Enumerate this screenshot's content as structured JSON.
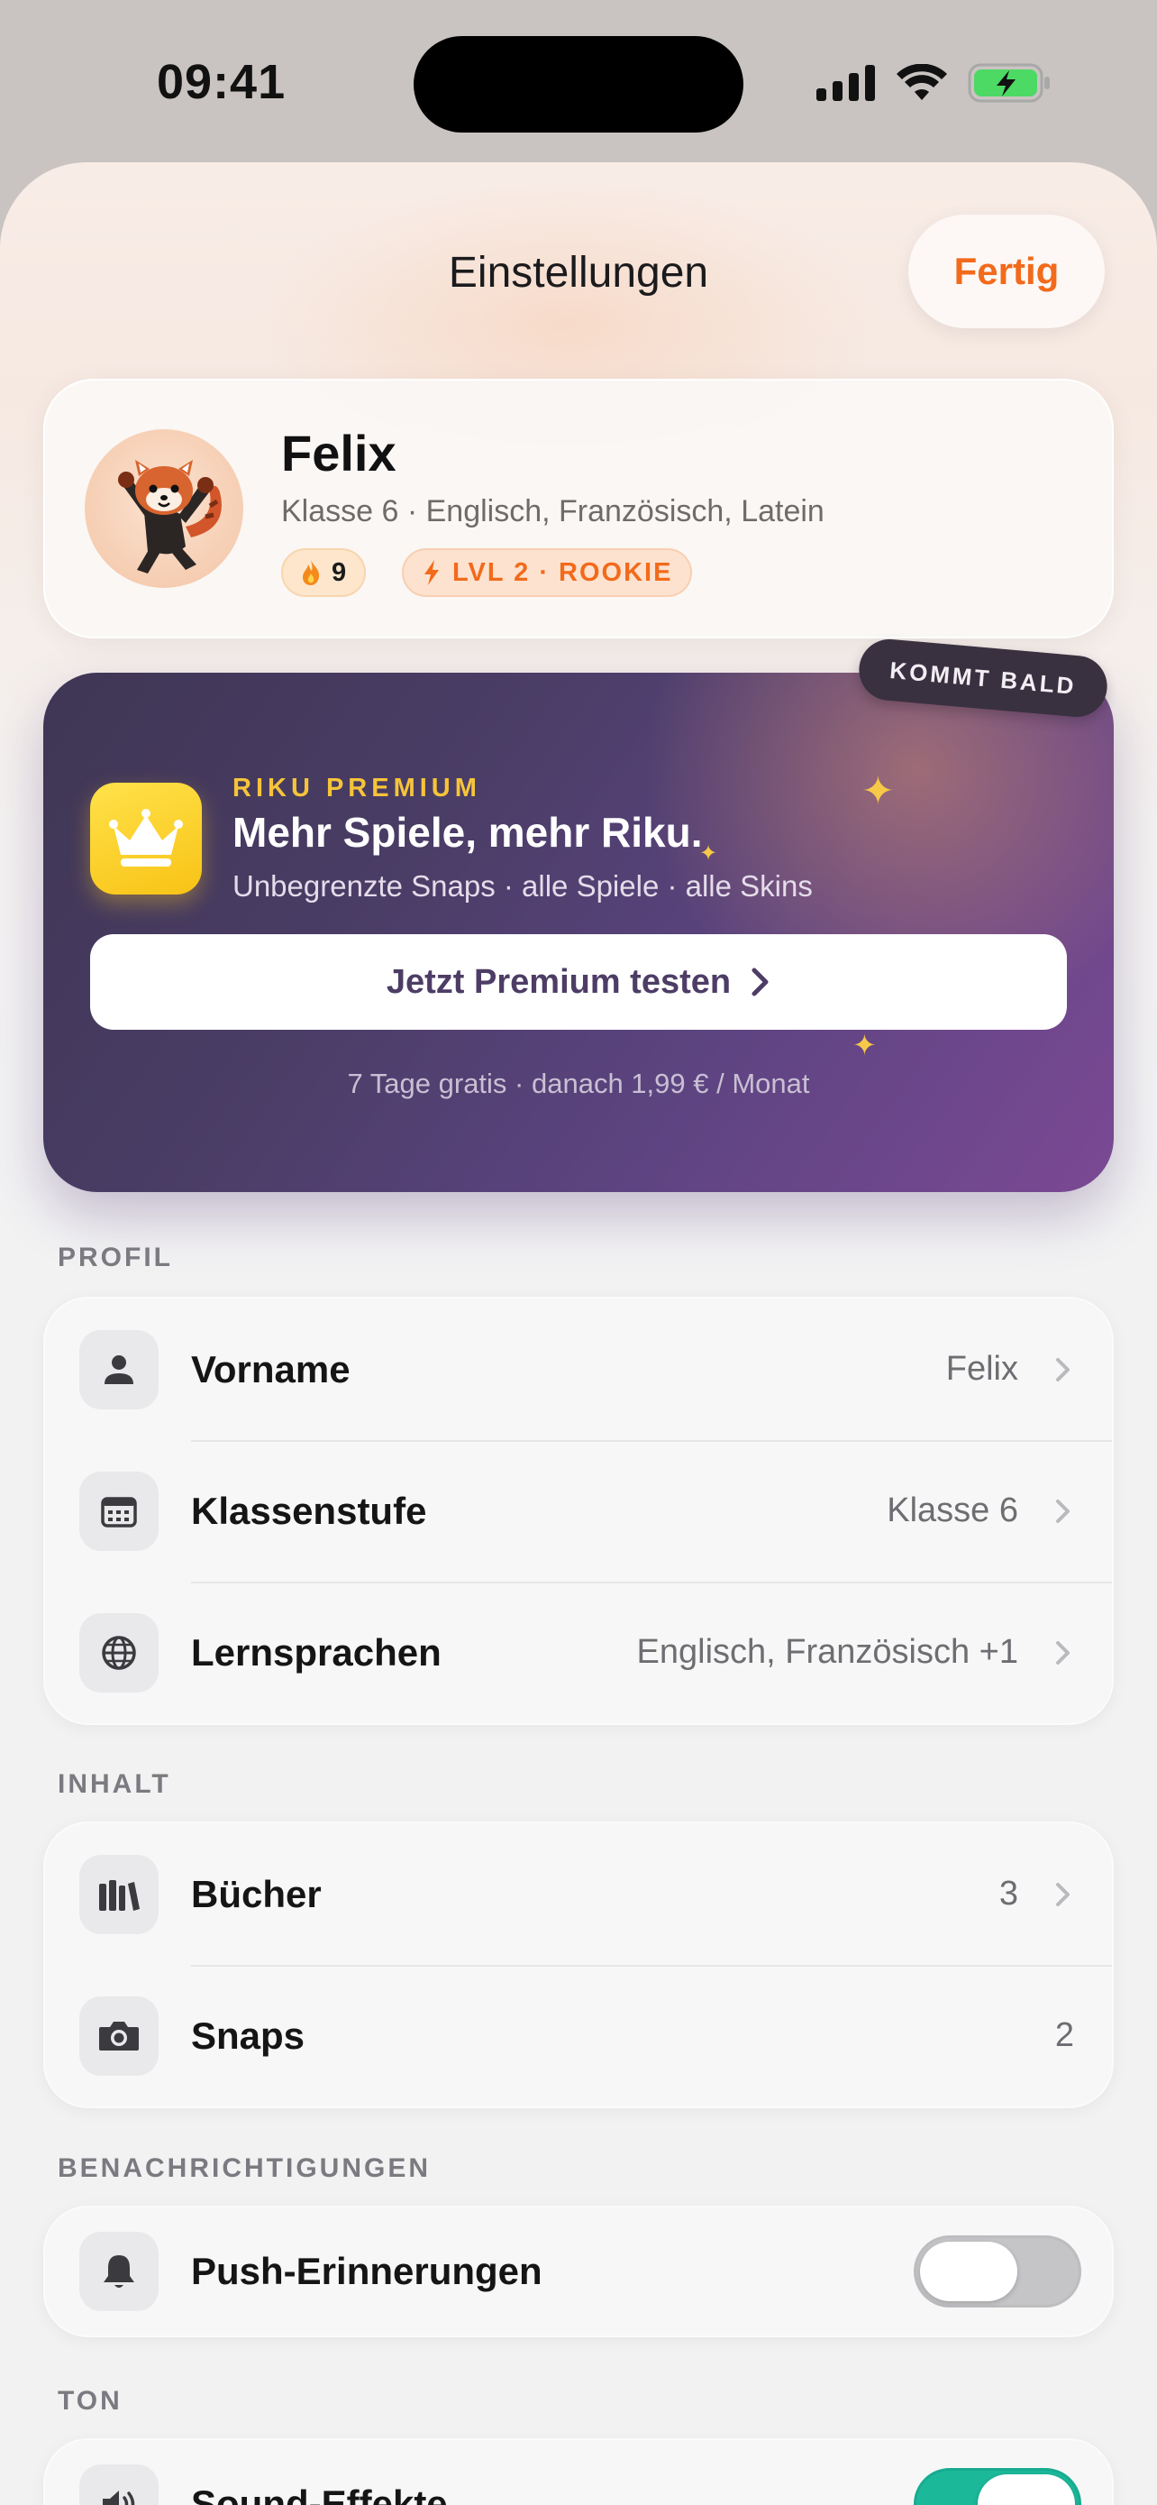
{
  "status_bar": {
    "time": "09:41"
  },
  "nav": {
    "title": "Einstellungen",
    "done_label": "Fertig"
  },
  "profile": {
    "name": "Felix",
    "subtitle": "Klasse 6 · Englisch, Französisch, Latein",
    "streak": "9",
    "level": "LVL 2 · ROOKIE"
  },
  "premium": {
    "badge": "KOMMT BALD",
    "eyebrow": "RIKU PREMIUM",
    "title": "Mehr Spiele, mehr Riku.",
    "subtitle": "Unbegrenzte Snaps · alle Spiele · alle Skins",
    "cta": "Jetzt Premium testen",
    "footnote": "7 Tage gratis · danach 1,99 € / Monat"
  },
  "sections": {
    "profil": {
      "label": "PROFIL",
      "rows": [
        {
          "label": "Vorname",
          "value": "Felix",
          "icon": "person-icon"
        },
        {
          "label": "Klassenstufe",
          "value": "Klasse 6",
          "icon": "calendar-icon"
        },
        {
          "label": "Lernsprachen",
          "value": "Englisch, Französisch +1",
          "icon": "globe-icon"
        }
      ]
    },
    "inhalt": {
      "label": "INHALT",
      "rows": [
        {
          "label": "Bücher",
          "value": "3",
          "icon": "books-icon"
        },
        {
          "label": "Snaps",
          "value": "2",
          "icon": "camera-icon"
        }
      ]
    },
    "benachrichtigungen": {
      "label": "BENACHRICHTIGUNGEN",
      "rows": [
        {
          "label": "Push-Erinnerungen",
          "toggle": false,
          "icon": "bell-icon"
        }
      ]
    },
    "ton": {
      "label": "TON",
      "rows": [
        {
          "label": "Sound-Effekte",
          "toggle": true,
          "icon": "speaker-icon"
        }
      ]
    }
  },
  "colors": {
    "accent": "#f26a1b",
    "premium_bg": "#4a3d66",
    "premium_gold": "#f6c43a",
    "toggle_on": "#1bb89a"
  }
}
